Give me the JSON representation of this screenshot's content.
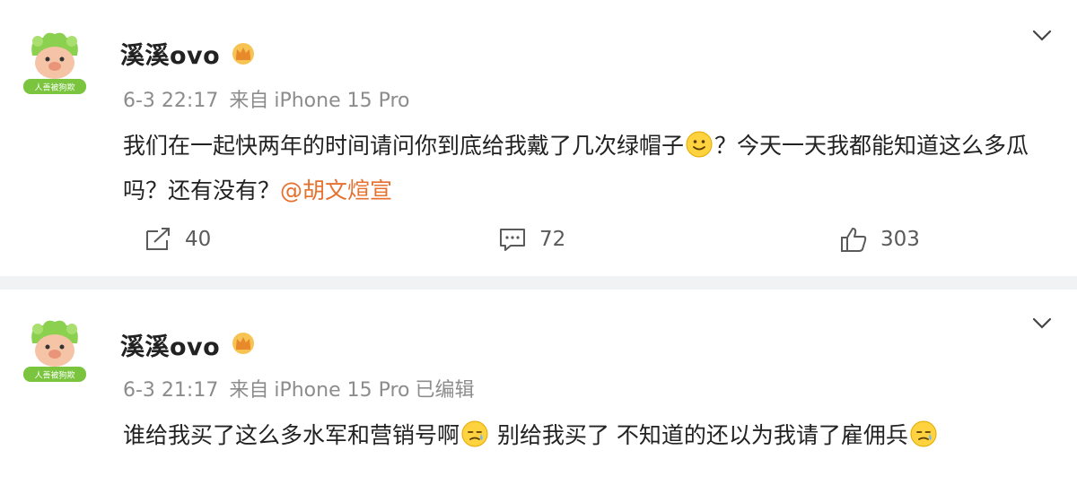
{
  "posts": [
    {
      "username": "溪溪ovo",
      "avatar_caption": "人善被狗欺",
      "date": "6-3 22:17",
      "source_prefix": "来自",
      "device": "iPhone 15 Pro",
      "edited": "",
      "text_part1": "我们在一起快两年的时间请问你到底给我戴了几次绿帽子",
      "text_part2": "？今天一天我都能知道这么多瓜吗？还有没有？",
      "mention": "@胡文煊宣",
      "emoji_1": "smile-emoji",
      "shares": "40",
      "comments": "72",
      "likes": "303"
    },
    {
      "username": "溪溪ovo",
      "avatar_caption": "人善被狗欺",
      "date": "6-3 21:17",
      "source_prefix": "来自",
      "device": "iPhone 15 Pro",
      "edited": "已编辑",
      "text_part1": "谁给我买了这么多水军和营销号啊",
      "text_part2": " 别给我买了 不知道的还以为我请了雇佣兵",
      "emoji_1": "sweat-emoji",
      "emoji_2": "sweat-emoji"
    }
  ],
  "colors": {
    "mention": "#e6712f",
    "meta": "#8c8c8c",
    "divider": "#f1f2f4",
    "avatar_green": "#8bd14f"
  },
  "icons": {
    "verified": "crown-badge-icon",
    "menu": "chevron-down-icon",
    "share": "share-icon",
    "comment": "comment-icon",
    "like": "thumbs-up-icon"
  }
}
